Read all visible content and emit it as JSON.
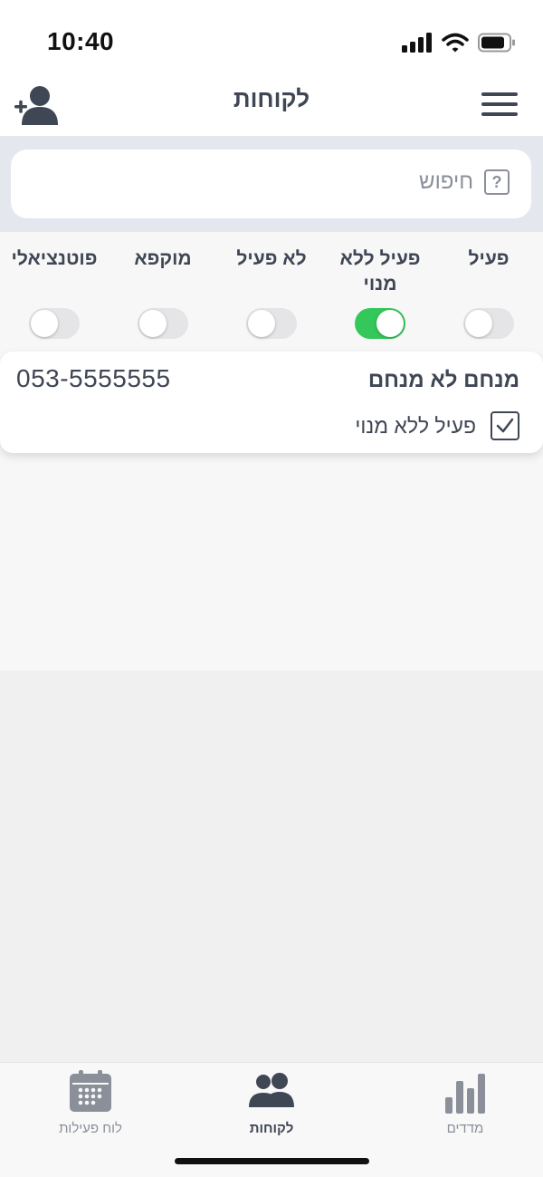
{
  "status_bar": {
    "time": "10:40"
  },
  "header": {
    "title": "לקוחות"
  },
  "search": {
    "placeholder": "חיפוש",
    "icon": "?"
  },
  "filters": [
    {
      "label": "פעיל",
      "on": false
    },
    {
      "label": "פעיל ללא מנוי",
      "on": true
    },
    {
      "label": "לא פעיל",
      "on": false
    },
    {
      "label": "מוקפא",
      "on": false
    },
    {
      "label": "פוטנציאלי",
      "on": false
    }
  ],
  "customers": [
    {
      "name": "מנחם לא מנחם",
      "phone": "053-5555555",
      "status": "פעיל ללא מנוי",
      "checked": true
    }
  ],
  "tabs": [
    {
      "label": "מדדים",
      "icon": "bar-chart-icon",
      "active": false
    },
    {
      "label": "לקוחות",
      "icon": "users-icon",
      "active": true
    },
    {
      "label": "לוח פעילות",
      "icon": "calendar-icon",
      "active": false
    }
  ],
  "colors": {
    "accent": "#34c759",
    "text": "#3f4654",
    "search_bg": "#e4e7ee"
  }
}
